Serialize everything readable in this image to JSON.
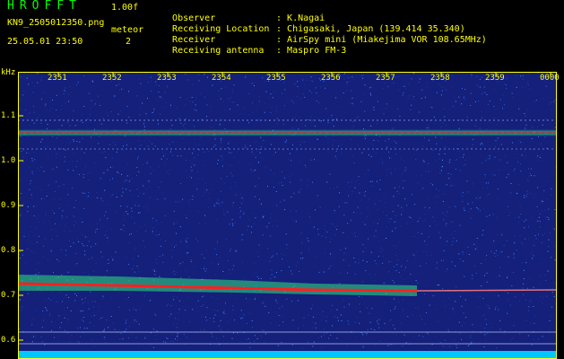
{
  "header": {
    "app_title": "HROFFT",
    "version": "1.00f",
    "filename": "KN9_2505012350.png",
    "meteor_label": "meteor",
    "meteor_count": "2",
    "datetime": "25.05.01 23:50",
    "info": [
      {
        "key": "Observer",
        "value": "K.Nagai"
      },
      {
        "key": "Receiving Location",
        "value": "Chigasaki, Japan (139.414 35.340)"
      },
      {
        "key": "Receiver",
        "value": "AirSpy mini (Miakejima VOR 108.65MHz)"
      },
      {
        "key": "Receiving antenna",
        "value": "Maspro FM-3"
      }
    ]
  },
  "plot": {
    "y_unit": "kHz",
    "y_ticks": [
      "1.1",
      "1.0",
      "0.9",
      "0.8",
      "0.7",
      "0.6"
    ],
    "x_ticks": [
      "2351",
      "2352",
      "2353",
      "2354",
      "2355",
      "2356",
      "2357",
      "2358",
      "2359",
      "0000"
    ],
    "colors": {
      "background": "#14207a",
      "noise": "#2a56d0",
      "signal_strong": "#ff2020",
      "signal_mid": "#30e080",
      "border": "#ffff00",
      "tick": "#ffff00"
    }
  }
}
